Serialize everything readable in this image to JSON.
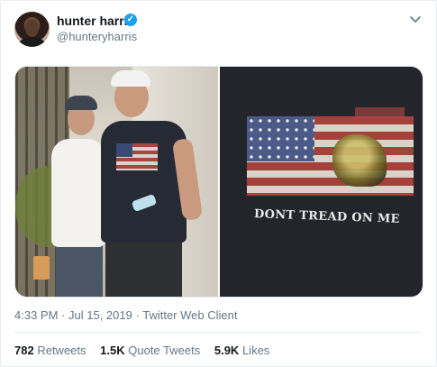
{
  "tweet": {
    "author": {
      "name": "hunter harris",
      "handle": "@hunteryharris",
      "verified": true
    },
    "media": {
      "image_right_text": "DONT TREAD ON ME"
    },
    "meta": {
      "time": "4:33 PM",
      "separator1": "·",
      "date": "Jul 15, 2019",
      "separator2": "·",
      "client": "Twitter Web Client"
    },
    "stats": {
      "retweets_count": "782",
      "retweets_label": "Retweets",
      "quotes_count": "1.5K",
      "quotes_label": "Quote Tweets",
      "likes_count": "5.9K",
      "likes_label": "Likes"
    }
  },
  "colors": {
    "verified": "#1da1f2",
    "secondary_text": "#657786",
    "primary_text": "#14171a",
    "border": "#e6ecf0"
  },
  "icons": {
    "verified": "verified-badge-icon",
    "menu": "chevron-down-icon"
  }
}
